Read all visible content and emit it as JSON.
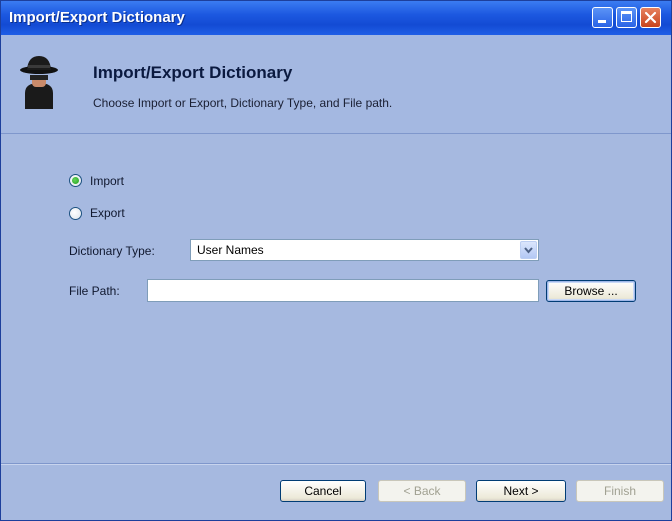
{
  "window": {
    "title": "Import/Export Dictionary",
    "controls": [
      "minimize-icon",
      "maximize-icon",
      "close-icon"
    ],
    "title_color": "#1c58e0",
    "background_color": "#a6b9e0"
  },
  "header": {
    "icon": "spy-hat-icon",
    "title": "Import/Export Dictionary",
    "subtitle": "Choose Import or Export, Dictionary Type, and File path."
  },
  "options": {
    "import_label": "Import",
    "export_label": "Export",
    "selected": "Import"
  },
  "dictionary_type": {
    "label": "Dictionary Type:",
    "value": "User Names"
  },
  "file_path": {
    "label": "File Path:",
    "value": "",
    "browse_label": "Browse ..."
  },
  "footer": {
    "cancel_label": "Cancel",
    "back_label": "< Back",
    "next_label": "Next >",
    "finish_label": "Finish"
  }
}
